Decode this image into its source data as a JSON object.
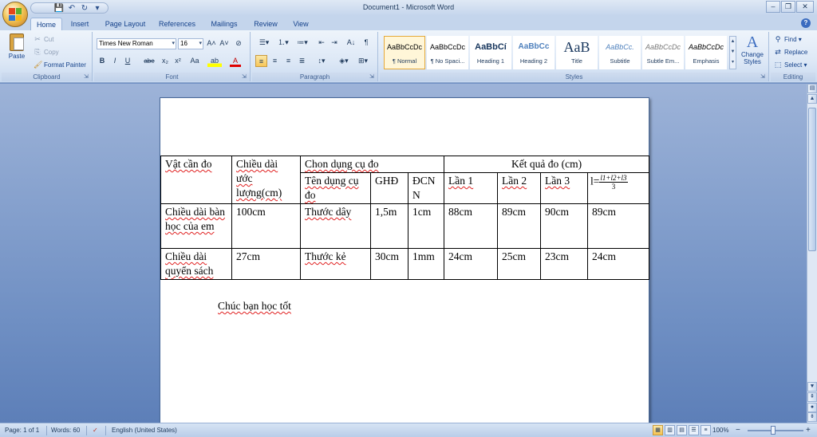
{
  "window": {
    "title": "Document1 - Microsoft Word",
    "controls": {
      "minimize": "–",
      "restore": "❐",
      "close": "✕"
    }
  },
  "quick_access": {
    "save": "💾",
    "undo": "↶",
    "redo": "↻",
    "customize": "▾"
  },
  "tabs": [
    "Home",
    "Insert",
    "Page Layout",
    "References",
    "Mailings",
    "Review",
    "View"
  ],
  "active_tab": "Home",
  "help": "?",
  "ribbon": {
    "clipboard": {
      "label": "Clipboard",
      "paste": "Paste",
      "cut": "Cut",
      "copy": "Copy",
      "format_painter": "Format Painter"
    },
    "font": {
      "label": "Font",
      "font_name": "Times New Roman",
      "font_size": "16",
      "grow": "A˄",
      "shrink": "A˅",
      "clear": "⊘",
      "bold": "B",
      "italic": "I",
      "underline": "U",
      "strike": "abe",
      "subscript": "x₂",
      "superscript": "x²",
      "change_case": "Aa",
      "highlight": "ab",
      "font_color": "A"
    },
    "paragraph": {
      "label": "Paragraph",
      "pilcrow": "¶",
      "sort": "A↓"
    },
    "styles": {
      "label": "Styles",
      "items": [
        {
          "sample": "AaBbCcDc",
          "name": "¶ Normal"
        },
        {
          "sample": "AaBbCcDc",
          "name": "¶ No Spaci..."
        },
        {
          "sample": "AaBbCí",
          "name": "Heading 1"
        },
        {
          "sample": "AaBbCc",
          "name": "Heading 2"
        },
        {
          "sample": "AaB",
          "name": "Title"
        },
        {
          "sample": "AaBbCc.",
          "name": "Subtitle"
        },
        {
          "sample": "AaBbCcDc",
          "name": "Subtle Em..."
        },
        {
          "sample": "AaBbCcDc",
          "name": "Emphasis"
        }
      ],
      "change_styles": "Change Styles"
    },
    "editing": {
      "label": "Editing",
      "find": "Find",
      "replace": "Replace",
      "select": "Select"
    }
  },
  "document": {
    "table": {
      "h_vat": "Vật cần đo",
      "h_chieu_dai": "Chiều dài ước lượng(cm)",
      "h_chon": "Chon dụng cụ đo",
      "h_ketqua": "Kết quả đo (cm)",
      "h_ten": "Tên dụng cụ đo",
      "h_ghd": "GHĐ",
      "h_dcnn": "ĐCNN",
      "h_lan1": "Lần 1",
      "h_lan2": "Lần 2",
      "h_lan3": "Lần 3",
      "h_l_prefix": "l=",
      "h_l_num": "l1+l2+l3",
      "h_l_den": "3",
      "rows": [
        [
          "Chiều dài bàn học của em",
          "100cm",
          "Thước dây",
          "1,5m",
          "1cm",
          "88cm",
          "89cm",
          "90cm",
          "89cm"
        ],
        [
          "Chiều dài quyển sách",
          "27cm",
          "Thước kẻ",
          "30cm",
          "1mm",
          "24cm",
          "25cm",
          "23cm",
          "24cm"
        ]
      ]
    },
    "closing": "Chúc bạn học tốt"
  },
  "statusbar": {
    "page": "Page: 1 of 1",
    "words": "Words: 60",
    "language": "English (United States)",
    "zoom": "100%",
    "zoom_out": "−",
    "zoom_in": "+"
  },
  "colors": {
    "accent": "#15428b",
    "ribbon": "#dde8f6",
    "doc_bg": "#6f8fc3"
  }
}
